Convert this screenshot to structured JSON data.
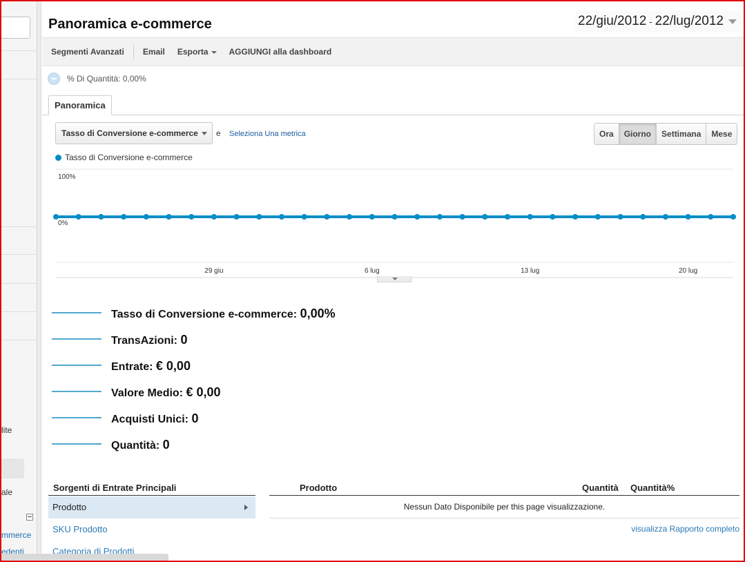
{
  "sidebar": {
    "fragments": [
      "lite",
      "ale",
      "mmerce",
      "edenti"
    ]
  },
  "header": {
    "title": "Panoramica e-commerce",
    "date_from": "22/giu/2012",
    "date_sep": "-",
    "date_to": "22/lug/2012"
  },
  "toolbar": {
    "advanced_segments": "Segmenti Avanzati",
    "email": "Email",
    "export": "Esporta",
    "add_dashboard": "AGGIUNGI alla dashboard"
  },
  "segment": {
    "label": "% Di Quantità: 0,00%"
  },
  "tabs": [
    {
      "label": "Panoramica",
      "active": true
    }
  ],
  "controls": {
    "metric_select": "Tasso di Conversione e-commerce",
    "and_text": "e",
    "select_metric": "Seleziona Una metrica",
    "periods": [
      {
        "label": "Ora",
        "active": false
      },
      {
        "label": "Giorno",
        "active": true
      },
      {
        "label": "Settimana",
        "active": false
      },
      {
        "label": "Mese",
        "active": false
      }
    ]
  },
  "legend": {
    "label": "Tasso di Conversione e-commerce",
    "color": "#058dc7"
  },
  "chart_data": {
    "type": "line",
    "series": [
      {
        "name": "Tasso di Conversione e-commerce",
        "color": "#058dc7",
        "values": [
          0,
          0,
          0,
          0,
          0,
          0,
          0,
          0,
          0,
          0,
          0,
          0,
          0,
          0,
          0,
          0,
          0,
          0,
          0,
          0,
          0,
          0,
          0,
          0,
          0,
          0,
          0,
          0,
          0,
          0,
          0
        ]
      }
    ],
    "x": [
      "22 giu",
      "23 giu",
      "24 giu",
      "25 giu",
      "26 giu",
      "27 giu",
      "28 giu",
      "29 giu",
      "30 giu",
      "1 lug",
      "2 lug",
      "3 lug",
      "4 lug",
      "5 lug",
      "6 lug",
      "7 lug",
      "8 lug",
      "9 lug",
      "10 lug",
      "11 lug",
      "12 lug",
      "13 lug",
      "14 lug",
      "15 lug",
      "16 lug",
      "17 lug",
      "18 lug",
      "19 lug",
      "20 lug",
      "21 lug",
      "22 lug"
    ],
    "x_ticks": [
      {
        "index": 7,
        "label": "29 giu"
      },
      {
        "index": 14,
        "label": "6 lug"
      },
      {
        "index": 21,
        "label": "13 lug"
      },
      {
        "index": 28,
        "label": "20 lug"
      }
    ],
    "y_ticks": [
      "100%",
      "0%"
    ],
    "ylim": [
      0,
      100
    ],
    "grid": true
  },
  "summary": [
    {
      "label": "Tasso di Conversione e-commerce:",
      "value": "0,00%"
    },
    {
      "label": "TransAzioni:",
      "value": "0"
    },
    {
      "label": "Entrate:",
      "value": "€ 0,00"
    },
    {
      "label": "Valore Medio:",
      "value": "€ 0,00"
    },
    {
      "label": "Acquisti Unici:",
      "value": "0"
    },
    {
      "label": "Quantità:",
      "value": "0"
    }
  ],
  "sources": {
    "header": "Sorgenti di Entrate Principali",
    "items": [
      {
        "label": "Prodotto",
        "active": true
      },
      {
        "label": "SKU Prodotto",
        "active": false
      },
      {
        "label": "Categoria di Prodotti",
        "active": false
      }
    ]
  },
  "table": {
    "headers": [
      "Prodotto",
      "Quantità",
      "Quantità%"
    ],
    "empty_message": "Nessun Dato Disponibile per this page visualizzazione.",
    "full_report": "visualizza Rapporto completo"
  }
}
